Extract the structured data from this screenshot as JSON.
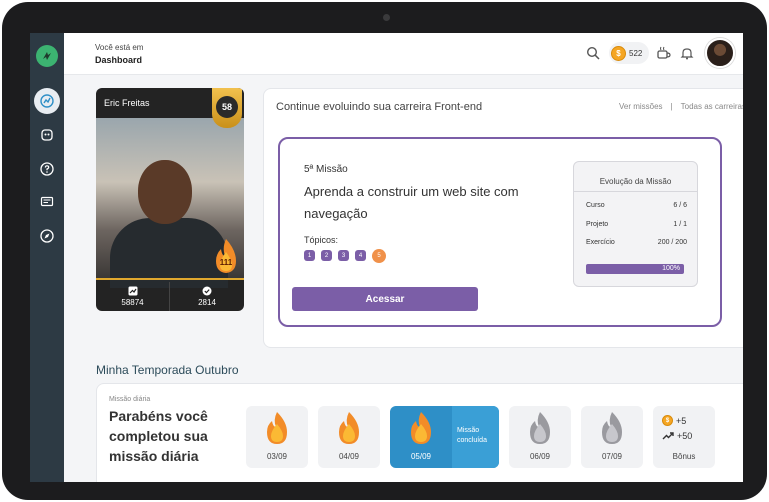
{
  "header": {
    "breadcrumb_small": "Você está em",
    "breadcrumb_title": "Dashboard",
    "coins": "522",
    "coin_symbol": "$"
  },
  "profile": {
    "name": "Eric Freitas",
    "level": "58",
    "streak": "111",
    "stats": [
      {
        "icon": "trend-icon",
        "value": "58874"
      },
      {
        "icon": "check-icon",
        "value": "2814"
      }
    ]
  },
  "mission_card": {
    "heading": "Continue evoluindo sua carreira Front-end",
    "link_missions": "Ver missões",
    "separator": "|",
    "link_careers": "Todas as carreiras",
    "mission_number": "5ª Missão",
    "mission_title": "Aprenda a construir um web site com navegação",
    "topics_label": "Tópicos:",
    "topics": [
      "1",
      "2",
      "3",
      "4",
      "5"
    ],
    "current_topic": "5",
    "access_label": "Acessar",
    "evolution": {
      "title": "Evolução da Missão",
      "rows": [
        {
          "label": "Curso",
          "value": "6 / 6"
        },
        {
          "label": "Projeto",
          "value": "1 / 1"
        },
        {
          "label": "Exercício",
          "value": "200 / 200"
        }
      ],
      "progress_label": "100%",
      "progress": 1.0
    }
  },
  "season": {
    "title": "Minha Temporada Outubro",
    "daily_label": "Missão diária",
    "daily_message": "Parabéns você completou sua missão diária",
    "days": [
      {
        "date": "03/09",
        "status": "done"
      },
      {
        "date": "04/09",
        "status": "done"
      },
      {
        "date": "05/09",
        "status": "today",
        "note": "Missão concluída"
      },
      {
        "date": "06/09",
        "status": "pending"
      },
      {
        "date": "07/09",
        "status": "pending"
      }
    ],
    "bonus": {
      "coins": "+5",
      "xp": "+50",
      "label": "Bônus"
    }
  },
  "colors": {
    "accent": "#7b5ea7",
    "sidebar": "#2d3a44",
    "active_day": "#2e8fc7",
    "fire": "#f28c28",
    "gold": "#e0a82e"
  }
}
